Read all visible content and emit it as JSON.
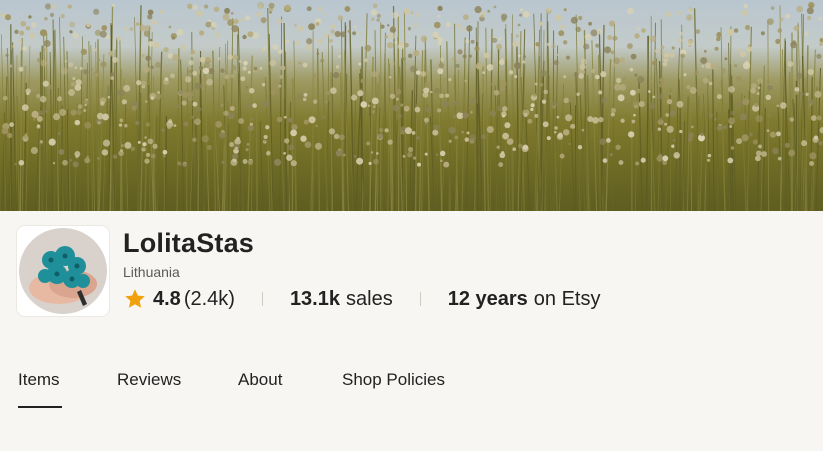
{
  "banner": {
    "description_icon": "flax-field-banner"
  },
  "shop": {
    "name": "LolitaStas",
    "location": "Lithuania",
    "rating": "4.8",
    "rating_count": "(2.4k)",
    "sales_value": "13.1k",
    "sales_label": "sales",
    "years_value": "12 years",
    "years_label": "on Etsy"
  },
  "tabs": [
    {
      "label": "Items",
      "active": true
    },
    {
      "label": "Reviews",
      "active": false
    },
    {
      "label": "About",
      "active": false
    },
    {
      "label": "Shop Policies",
      "active": false
    }
  ],
  "colors": {
    "background": "#f8f6f2",
    "text": "#222222",
    "muted": "#595959",
    "star": "#f1a10d",
    "avatar_flowers": "#1f8f9a"
  }
}
